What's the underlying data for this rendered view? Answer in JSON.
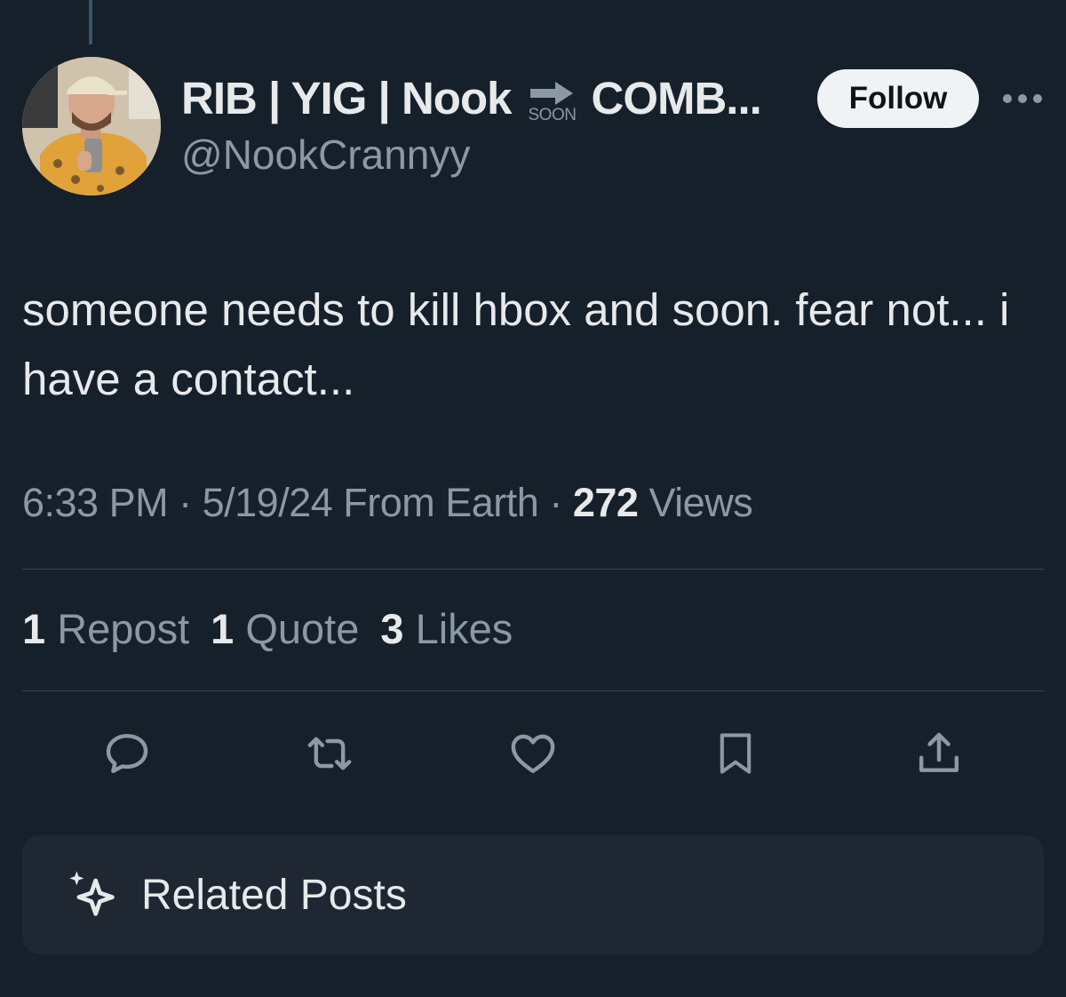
{
  "author": {
    "name_part1": "RIB | YIG | Nook",
    "name_soon": "SOON",
    "name_part2": "COMB...",
    "handle": "@NookCrannyy"
  },
  "follow_label": "Follow",
  "tweet_text": "someone needs to kill hbox and soon. fear not... i have a contact...",
  "meta": {
    "time": "6:33 PM",
    "date": "5/19/24",
    "location": "From Earth",
    "views_count": "272",
    "views_label": "Views",
    "separator": "·"
  },
  "stats": {
    "reposts_count": "1",
    "reposts_label": "Repost",
    "quotes_count": "1",
    "quotes_label": "Quote",
    "likes_count": "3",
    "likes_label": "Likes"
  },
  "actions": [
    "reply-icon",
    "retweet-icon",
    "like-icon",
    "bookmark-icon",
    "share-icon"
  ],
  "related_label": "Related Posts",
  "colors": {
    "background": "#15202b",
    "text": "#e7e9ea",
    "secondary_text": "#8b98a5",
    "divider": "#38444d",
    "follow_bg": "#eff3f4",
    "card_bg": "#1e2732"
  }
}
